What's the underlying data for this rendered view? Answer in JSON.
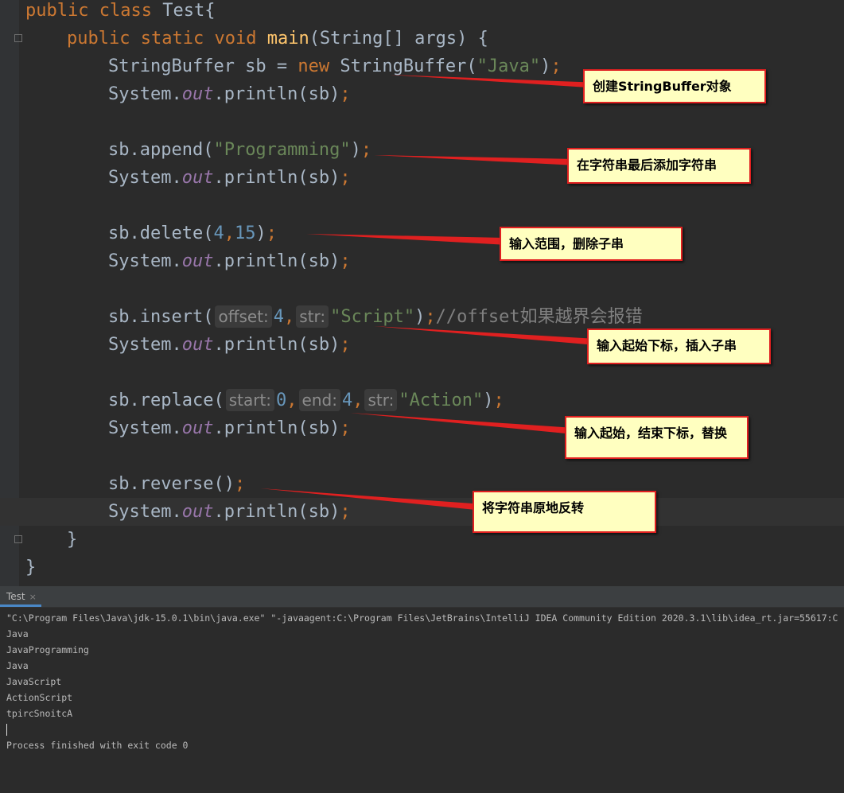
{
  "editor": {
    "code": {
      "l1_kw1": "public",
      "l1_kw2": "class",
      "l1_rest": " Test{",
      "l2_kw1": "public",
      "l2_kw2": "static",
      "l2_kw3": "void",
      "l2_fn": "main",
      "l2_rest": "(String[] args) {",
      "l3_pre": "StringBuffer sb = ",
      "l3_kw": "new",
      "l3_mid": " StringBuffer(",
      "l3_str": "\"Java\"",
      "l3_post": ")",
      "semicolon": ";",
      "print_pre": "System.",
      "print_field": "out",
      "print_post": ".println(sb)",
      "l6_pre": "sb.append(",
      "l6_str": "\"Programming\"",
      "l6_post": ")",
      "l9_pre": "sb.delete(",
      "l9_num1": "4",
      "comma": ",",
      "l9_num2": "15",
      "l9_post": ")",
      "l12_pre": "sb.insert(",
      "l12_hint1": "offset:",
      "l12_num": "4",
      "l12_hint2": "str:",
      "l12_str": "\"Script\"",
      "l12_post": ")",
      "l12_comment": "//offset如果越界会报错",
      "l15_pre": "sb.replace(",
      "l15_hint1": "start:",
      "l15_num1": "0",
      "l15_hint2": "end:",
      "l15_num2": "4",
      "l15_hint3": "str:",
      "l15_str": "\"Action\"",
      "l15_post": ")",
      "l18_text": "sb.reverse()",
      "close_inner": "}",
      "close_outer": "}"
    }
  },
  "annotations": {
    "a1": "创建StringBuffer对象",
    "a2": "在字符串最后添加字符串",
    "a3": "输入范围，删除子串",
    "a4": "输入起始下标，插入子串",
    "a5": "输入起始，结束下标，替换",
    "a6": "将字符串原地反转"
  },
  "annotation_color": "#e02020",
  "run_panel": {
    "tab_label": "Test",
    "tab_close": "×",
    "console": {
      "command": "\"C:\\Program Files\\Java\\jdk-15.0.1\\bin\\java.exe\" \"-javaagent:C:\\Program Files\\JetBrains\\IntelliJ IDEA Community Edition 2020.3.1\\lib\\idea_rt.jar=55617:C",
      "out1": "Java",
      "out2": "JavaProgramming",
      "out3": "Java",
      "out4": "JavaScript",
      "out5": "ActionScript",
      "out6": "tpircSnoitcA",
      "exit": "Process finished with exit code 0"
    }
  }
}
